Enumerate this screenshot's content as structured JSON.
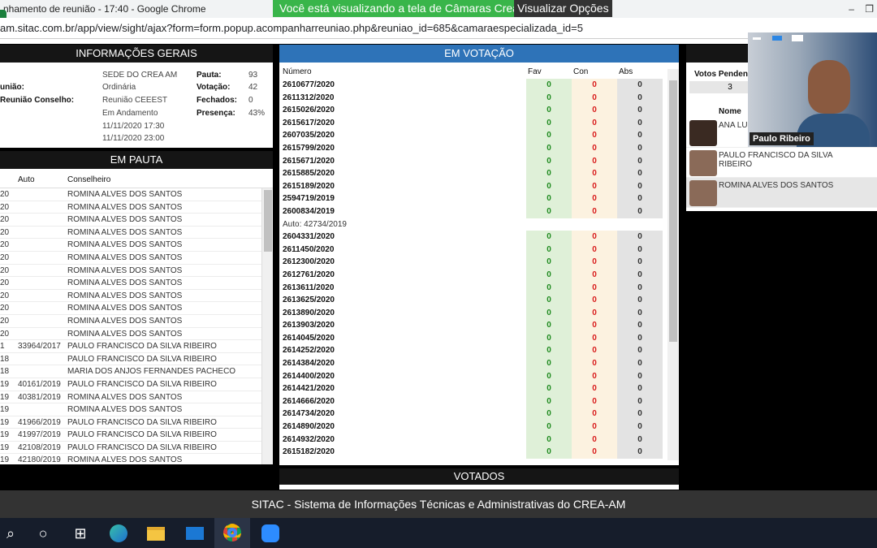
{
  "browser": {
    "title": "nhamento de reunião - 17:40 - Google Chrome",
    "url": "am.sitac.com.br/app/view/sight/ajax?form=form.popup.acompanharreuniao.php&reuniao_id=685&camaraespecializada_id=5"
  },
  "share": {
    "banner": "Você está visualizando a tela de Câmaras Crea",
    "options": "Visualizar Opções"
  },
  "info": {
    "title": "INFORMAÇÕES GERAIS",
    "labels": [
      "união:",
      "Reunião Conselho:"
    ],
    "values": [
      "SEDE DO CREA AM",
      "Ordinária",
      "Reunião CEEEST",
      "Em Andamento",
      "11/11/2020 17:30",
      "11/11/2020 23:00"
    ],
    "stats": [
      {
        "label": "Pauta:",
        "value": "93"
      },
      {
        "label": "Votação:",
        "value": "42"
      },
      {
        "label": "Fechados:",
        "value": "0"
      },
      {
        "label": "Presença:",
        "value": "43%"
      }
    ]
  },
  "pauta": {
    "title": "EM PAUTA",
    "col_auto": "Auto",
    "col_conselheiro": "Conselheiro",
    "rows": [
      {
        "num": "20",
        "auto": "",
        "cons": "ROMINA ALVES DOS SANTOS"
      },
      {
        "num": "20",
        "auto": "",
        "cons": "ROMINA ALVES DOS SANTOS"
      },
      {
        "num": "20",
        "auto": "",
        "cons": "ROMINA ALVES DOS SANTOS"
      },
      {
        "num": "20",
        "auto": "",
        "cons": "ROMINA ALVES DOS SANTOS"
      },
      {
        "num": "20",
        "auto": "",
        "cons": "ROMINA ALVES DOS SANTOS"
      },
      {
        "num": "20",
        "auto": "",
        "cons": "ROMINA ALVES DOS SANTOS"
      },
      {
        "num": "20",
        "auto": "",
        "cons": "ROMINA ALVES DOS SANTOS"
      },
      {
        "num": "20",
        "auto": "",
        "cons": "ROMINA ALVES DOS SANTOS"
      },
      {
        "num": "20",
        "auto": "",
        "cons": "ROMINA ALVES DOS SANTOS"
      },
      {
        "num": "20",
        "auto": "",
        "cons": "ROMINA ALVES DOS SANTOS"
      },
      {
        "num": "20",
        "auto": "",
        "cons": "ROMINA ALVES DOS SANTOS"
      },
      {
        "num": "20",
        "auto": "",
        "cons": "ROMINA ALVES DOS SANTOS"
      },
      {
        "num": "1",
        "auto": "33964/2017",
        "cons": "PAULO FRANCISCO DA SILVA RIBEIRO"
      },
      {
        "num": "18",
        "auto": "",
        "cons": "PAULO FRANCISCO DA SILVA RIBEIRO"
      },
      {
        "num": "18",
        "auto": "",
        "cons": "MARIA DOS ANJOS FERNANDES PACHECO"
      },
      {
        "num": "19",
        "auto": "40161/2019",
        "cons": "PAULO FRANCISCO DA SILVA RIBEIRO"
      },
      {
        "num": "19",
        "auto": "40381/2019",
        "cons": "ROMINA ALVES DOS SANTOS"
      },
      {
        "num": "19",
        "auto": "",
        "cons": "ROMINA ALVES DOS SANTOS"
      },
      {
        "num": "19",
        "auto": "41966/2019",
        "cons": "PAULO FRANCISCO DA SILVA RIBEIRO"
      },
      {
        "num": "19",
        "auto": "41997/2019",
        "cons": "PAULO FRANCISCO DA SILVA RIBEIRO"
      },
      {
        "num": "19",
        "auto": "42108/2019",
        "cons": "PAULO FRANCISCO DA SILVA RIBEIRO"
      },
      {
        "num": "19",
        "auto": "42180/2019",
        "cons": "ROMINA ALVES DOS SANTOS"
      }
    ]
  },
  "votacao": {
    "title": "EM VOTAÇÃO",
    "col_numero": "Número",
    "col_fav": "Fav",
    "col_con": "Con",
    "col_abs": "Abs",
    "rows": [
      {
        "num": "2610677/2020",
        "fav": "0",
        "con": "0",
        "abs": "0"
      },
      {
        "num": "2611312/2020",
        "fav": "0",
        "con": "0",
        "abs": "0"
      },
      {
        "num": "2615026/2020",
        "fav": "0",
        "con": "0",
        "abs": "0"
      },
      {
        "num": "2615617/2020",
        "fav": "0",
        "con": "0",
        "abs": "0"
      },
      {
        "num": "2607035/2020",
        "fav": "0",
        "con": "0",
        "abs": "0"
      },
      {
        "num": "2615799/2020",
        "fav": "0",
        "con": "0",
        "abs": "0"
      },
      {
        "num": "2615671/2020",
        "fav": "0",
        "con": "0",
        "abs": "0"
      },
      {
        "num": "2615885/2020",
        "fav": "0",
        "con": "0",
        "abs": "0"
      },
      {
        "num": "2615189/2020",
        "fav": "0",
        "con": "0",
        "abs": "0"
      },
      {
        "num": "2594719/2019",
        "fav": "0",
        "con": "0",
        "abs": "0"
      },
      {
        "num": "2600834/2019",
        "fav": "0",
        "con": "0",
        "abs": "0"
      },
      {
        "num": "Auto: 42734/2019",
        "fav": "",
        "con": "",
        "abs": "",
        "auto": true
      },
      {
        "num": "2604331/2020",
        "fav": "0",
        "con": "0",
        "abs": "0"
      },
      {
        "num": "2611450/2020",
        "fav": "0",
        "con": "0",
        "abs": "0"
      },
      {
        "num": "2612300/2020",
        "fav": "0",
        "con": "0",
        "abs": "0"
      },
      {
        "num": "2612761/2020",
        "fav": "0",
        "con": "0",
        "abs": "0"
      },
      {
        "num": "2613611/2020",
        "fav": "0",
        "con": "0",
        "abs": "0"
      },
      {
        "num": "2613625/2020",
        "fav": "0",
        "con": "0",
        "abs": "0"
      },
      {
        "num": "2613890/2020",
        "fav": "0",
        "con": "0",
        "abs": "0"
      },
      {
        "num": "2613903/2020",
        "fav": "0",
        "con": "0",
        "abs": "0"
      },
      {
        "num": "2614045/2020",
        "fav": "0",
        "con": "0",
        "abs": "0"
      },
      {
        "num": "2614252/2020",
        "fav": "0",
        "con": "0",
        "abs": "0"
      },
      {
        "num": "2614384/2020",
        "fav": "0",
        "con": "0",
        "abs": "0"
      },
      {
        "num": "2614400/2020",
        "fav": "0",
        "con": "0",
        "abs": "0"
      },
      {
        "num": "2614421/2020",
        "fav": "0",
        "con": "0",
        "abs": "0"
      },
      {
        "num": "2614666/2020",
        "fav": "0",
        "con": "0",
        "abs": "0"
      },
      {
        "num": "2614734/2020",
        "fav": "0",
        "con": "0",
        "abs": "0"
      },
      {
        "num": "2614890/2020",
        "fav": "0",
        "con": "0",
        "abs": "0"
      },
      {
        "num": "2614932/2020",
        "fav": "0",
        "con": "0",
        "abs": "0"
      },
      {
        "num": "2615182/2020",
        "fav": "0",
        "con": "0",
        "abs": "0"
      }
    ]
  },
  "votados": {
    "title": "VOTADOS"
  },
  "pendentes": {
    "votos_label": "Votos Penden",
    "votos_value": "3",
    "col_nome": "Nome",
    "people": [
      {
        "name": "ANA LU",
        "avatar": "female-avatar-icon"
      },
      {
        "name": "PAULO FRANCISCO DA SILVA RIBEIRO",
        "avatar": "male-avatar-icon"
      },
      {
        "name": "ROMINA ALVES DOS SANTOS",
        "avatar": "male-avatar-icon"
      }
    ]
  },
  "video": {
    "participant": "Paulo Ribeiro"
  },
  "footer": {
    "text": "SITAC - Sistema de Informações Técnicas e Administrativas do CREA-AM"
  },
  "taskbar": {
    "icons": [
      "search-icon",
      "task-view-icon",
      "widgets-icon",
      "edge-icon",
      "file-explorer-icon",
      "mail-icon",
      "chrome-icon",
      "zoom-icon"
    ]
  }
}
